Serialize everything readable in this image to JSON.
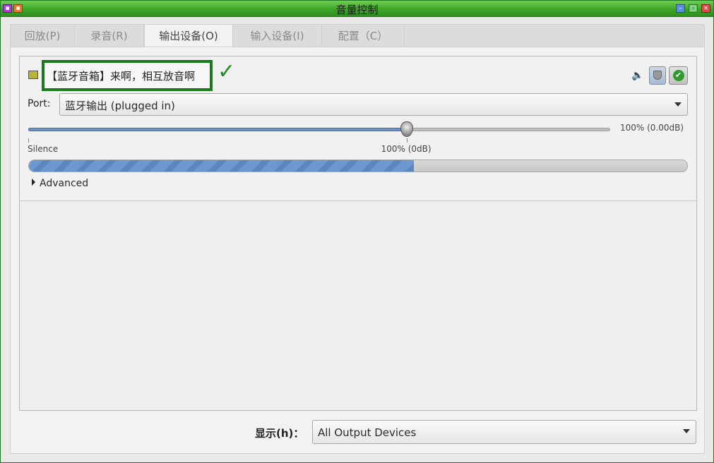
{
  "window": {
    "title": "音量控制"
  },
  "tabs": [
    {
      "label": "回放(P)"
    },
    {
      "label": "录音(R)"
    },
    {
      "label": "输出设备(O)",
      "active": true
    },
    {
      "label": "输入设备(I)"
    },
    {
      "label": "配置（C）"
    }
  ],
  "device": {
    "name": "【蓝牙音箱】来啊，相互放音啊",
    "check_glyph": "✓",
    "port_label": "Port:",
    "port_value": "蓝牙输出  (plugged in)",
    "volume_percent": 65,
    "volume_text": "100% (0.00dB)",
    "silence_label": "Silence",
    "unity_label": "100% (0dB)",
    "peak_level": 0.585,
    "advanced_label": "Advanced",
    "icons": {
      "card": "sound-card-icon",
      "mute": "speaker-mute-icon",
      "lock": "lock-channels-icon",
      "default": "set-default-icon"
    }
  },
  "footer": {
    "show_label": "显示(h)：",
    "show_value": "All Output Devices"
  },
  "colors": {
    "accent_green": "#1b7a1b",
    "titlebar": "#3ea52a",
    "slider_fill": "#6d94c4"
  }
}
